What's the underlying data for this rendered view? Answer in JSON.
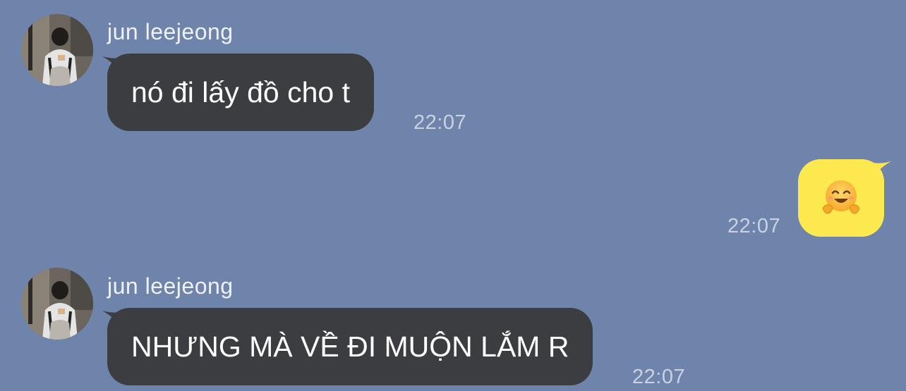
{
  "messages": [
    {
      "direction": "incoming",
      "sender": "jun leejeong",
      "text": "nó đi lấy đồ cho t",
      "time": "22:07"
    },
    {
      "direction": "outgoing",
      "emoji": "hugging-face-emoji",
      "time": "22:07"
    },
    {
      "direction": "incoming",
      "sender": "jun leejeong",
      "text": "NHƯNG MÀ VỀ ĐI MUỘN LẮM R",
      "time": "22:07"
    }
  ],
  "colors": {
    "background": "#6f84aa",
    "incoming_bubble": "#3c3d40",
    "outgoing_bubble": "#fbe94f",
    "sender_text": "#eef1f7",
    "timestamp_text": "#c9d2e3"
  }
}
